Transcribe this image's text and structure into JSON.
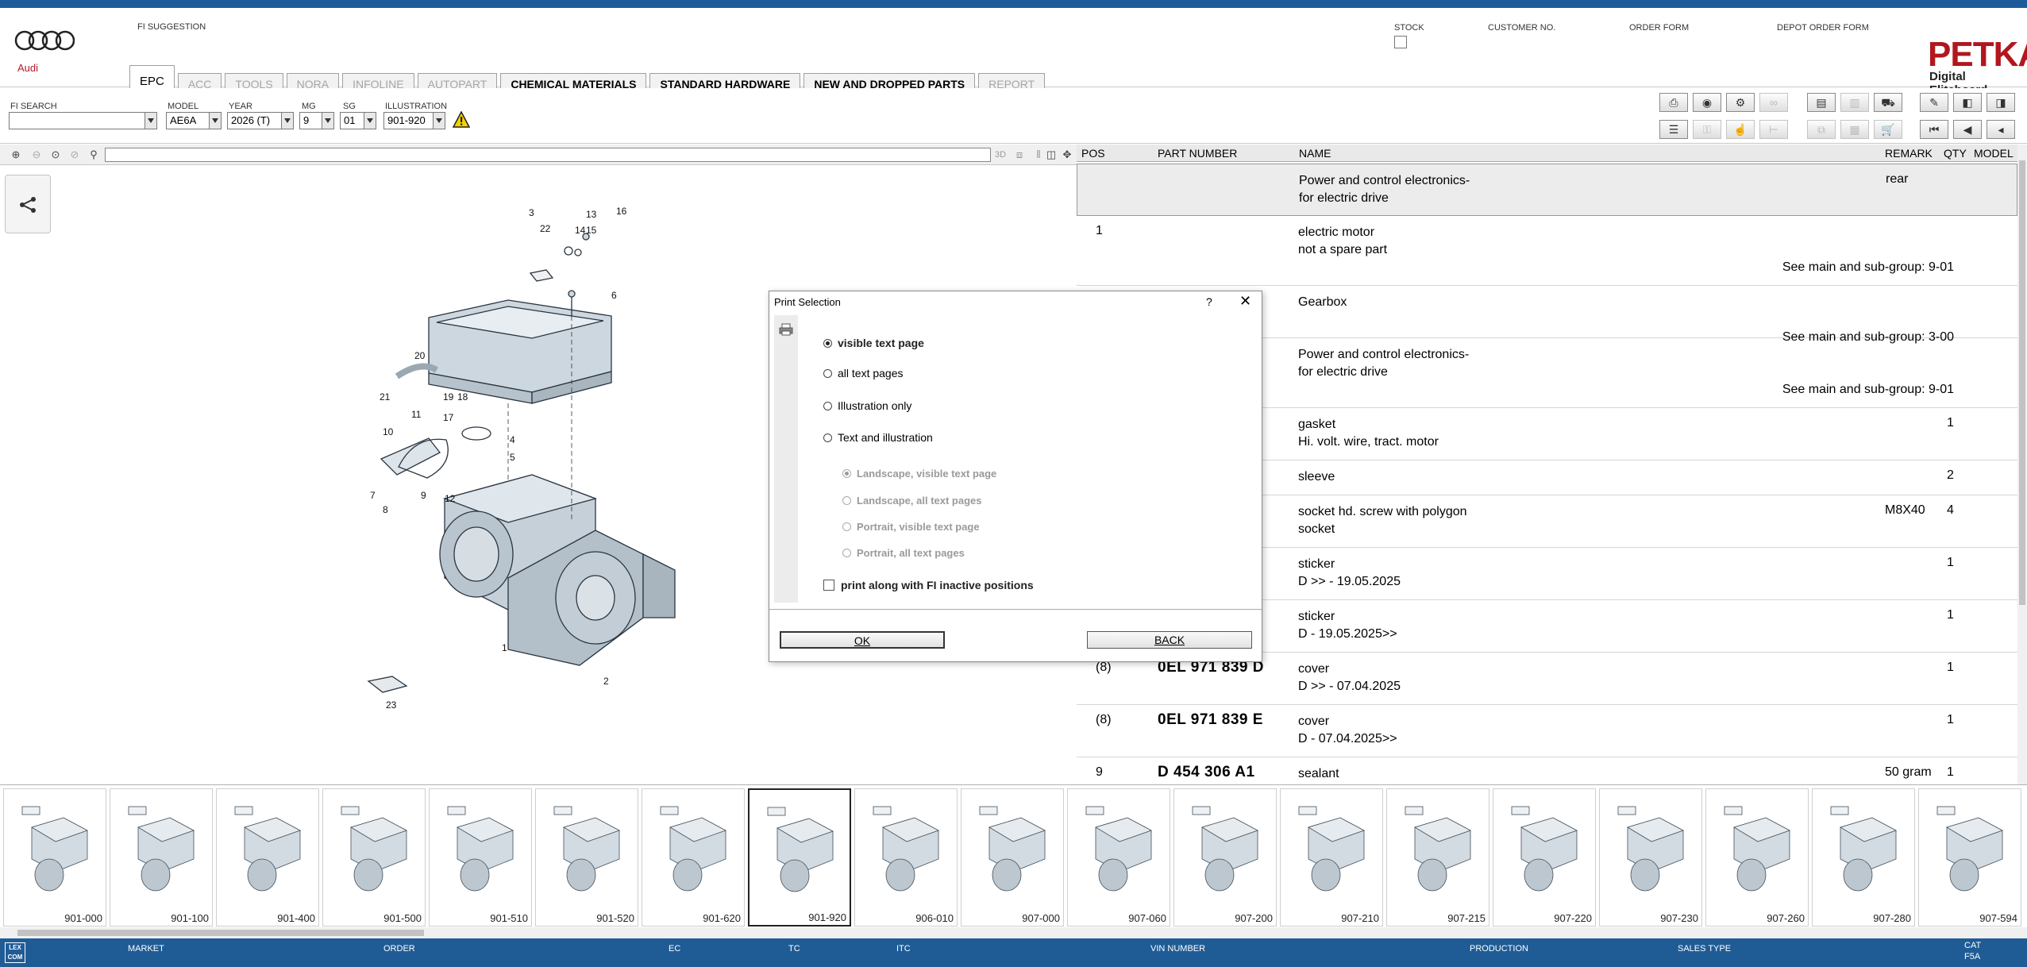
{
  "header": {
    "brand": "Audi",
    "fi_suggestion_label": "FI SUGGESTION",
    "stock_label": "STOCK",
    "customer_no_label": "CUSTOMER NO.",
    "order_form_label": "ORDER FORM",
    "depot_order_form_label": "DEPOT ORDER FORM",
    "app_name": "PETKA",
    "app_subtitle": "Digital Eliteboard"
  },
  "tabs": [
    {
      "label": "EPC",
      "state": "active"
    },
    {
      "label": "ACC",
      "state": "disabled"
    },
    {
      "label": "TOOLS",
      "state": "disabled"
    },
    {
      "label": "NORA",
      "state": "disabled"
    },
    {
      "label": "INFOLINE",
      "state": "disabled"
    },
    {
      "label": "AUTOPART",
      "state": "disabled"
    },
    {
      "label": "CHEMICAL MATERIALS",
      "state": "enabled"
    },
    {
      "label": "STANDARD HARDWARE",
      "state": "enabled"
    },
    {
      "label": "NEW AND DROPPED PARTS",
      "state": "enabled"
    },
    {
      "label": "REPORT",
      "state": "disabled"
    }
  ],
  "selectors": {
    "fi_search": {
      "label": "FI SEARCH",
      "value": ""
    },
    "model": {
      "label": "MODEL",
      "value": "AE6A"
    },
    "year": {
      "label": "YEAR",
      "value": "2026 (T)"
    },
    "mg": {
      "label": "MG",
      "value": "9"
    },
    "sg": {
      "label": "SG",
      "value": "01"
    },
    "illustration": {
      "label": "ILLUSTRATION",
      "value": "901-920"
    }
  },
  "illu_toolbar": {
    "view_3d": "3D"
  },
  "table": {
    "headers": {
      "pos": "POS",
      "part_number": "PART NUMBER",
      "name": "NAME",
      "remark": "REMARK",
      "qty": "QTY",
      "model": "MODEL"
    },
    "rows": [
      {
        "pos": "",
        "part_number": "",
        "name1": "Power and control electronics-",
        "name2": "for electric drive",
        "see": "",
        "remark": "rear",
        "qty": ""
      },
      {
        "pos": "1",
        "part_number": "",
        "name1": "electric motor",
        "name2": "not a spare part",
        "see": "See main and sub-group:   9-01",
        "remark": "",
        "qty": ""
      },
      {
        "pos": "",
        "part_number": "",
        "name1": "Gearbox",
        "name2": "",
        "see": "See main and sub-group:   3-00",
        "remark": "",
        "qty": ""
      },
      {
        "pos": "",
        "part_number": "",
        "name1": "Power and control electronics-",
        "name2": "for electric drive",
        "see": "See main and sub-group:   9-01",
        "remark": "",
        "qty": ""
      },
      {
        "pos": "",
        "part_number": "",
        "name1": "gasket",
        "name2": "Hi. volt. wire, tract. motor",
        "see": "",
        "remark": "",
        "qty": "1"
      },
      {
        "pos": "",
        "part_number": "",
        "name1": "sleeve",
        "name2": "",
        "see": "",
        "remark": "",
        "qty": "2"
      },
      {
        "pos": "",
        "part_number": "",
        "name1": "socket hd. screw with polygon",
        "name2": "socket",
        "see": "",
        "remark": "M8X40",
        "qty": "4"
      },
      {
        "pos": "",
        "part_number": "",
        "name1": "sticker",
        "name2": "D           >> - 19.05.2025",
        "see": "",
        "remark": "",
        "qty": "1"
      },
      {
        "pos": "",
        "part_number": "",
        "name1": "sticker",
        "name2": "D - 19.05.2025>>",
        "see": "",
        "remark": "",
        "qty": "1"
      },
      {
        "pos": "(8)",
        "part_number": "0EL 971 839 D",
        "name1": "cover",
        "name2": "D           >> - 07.04.2025",
        "see": "",
        "remark": "",
        "qty": "1"
      },
      {
        "pos": "(8)",
        "part_number": "0EL 971 839 E",
        "name1": "cover",
        "name2": "D - 07.04.2025>>",
        "see": "",
        "remark": "",
        "qty": "1"
      },
      {
        "pos": "9",
        "part_number": "D   454 306 A1",
        "name1": "sealant",
        "name2": "",
        "see": "",
        "remark": "50 gram",
        "qty": "1"
      }
    ]
  },
  "diagram_callouts": [
    "3",
    "13",
    "16",
    "22",
    "14",
    "15",
    "6",
    "20",
    "21",
    "19",
    "18",
    "17",
    "11",
    "10",
    "4",
    "5",
    "7",
    "9",
    "12",
    "8",
    "1",
    "2",
    "23"
  ],
  "thumbnails": [
    "901-000",
    "901-100",
    "901-400",
    "901-500",
    "901-510",
    "901-520",
    "901-620",
    "901-920",
    "906-010",
    "907-000",
    "907-060",
    "907-200",
    "907-210",
    "907-215",
    "907-220",
    "907-230",
    "907-260",
    "907-280",
    "907-594"
  ],
  "selected_thumbnail": "901-920",
  "statusbar": {
    "logo": "LEX COM",
    "market": "MARKET",
    "order": "ORDER",
    "ec": "EC",
    "tc": "TC",
    "itc": "ITC",
    "vin": "VIN NUMBER",
    "production": "PRODUCTION",
    "sales_type": "SALES TYPE",
    "cat": "CAT",
    "cat_value": "F5A"
  },
  "dialog": {
    "title": "Print Selection",
    "help": "?",
    "close": "✕",
    "options": {
      "visible_text_page": "visible text page",
      "all_text_pages": "all text pages",
      "illustration_only": "Illustration only",
      "text_and_illustration": "Text and illustration"
    },
    "sub_options": {
      "landscape_visible": "Landscape, visible text page",
      "landscape_all": "Landscape, all text pages",
      "portrait_visible": "Portrait, visible text page",
      "portrait_all": "Portrait, all text pages"
    },
    "inactive_label": "print along with FI inactive positions",
    "ok": "OK",
    "back": "BACK"
  },
  "colors": {
    "statusbar": "#1f5c96",
    "brand_red": "#b2161e",
    "audi_red": "#b5192b"
  }
}
